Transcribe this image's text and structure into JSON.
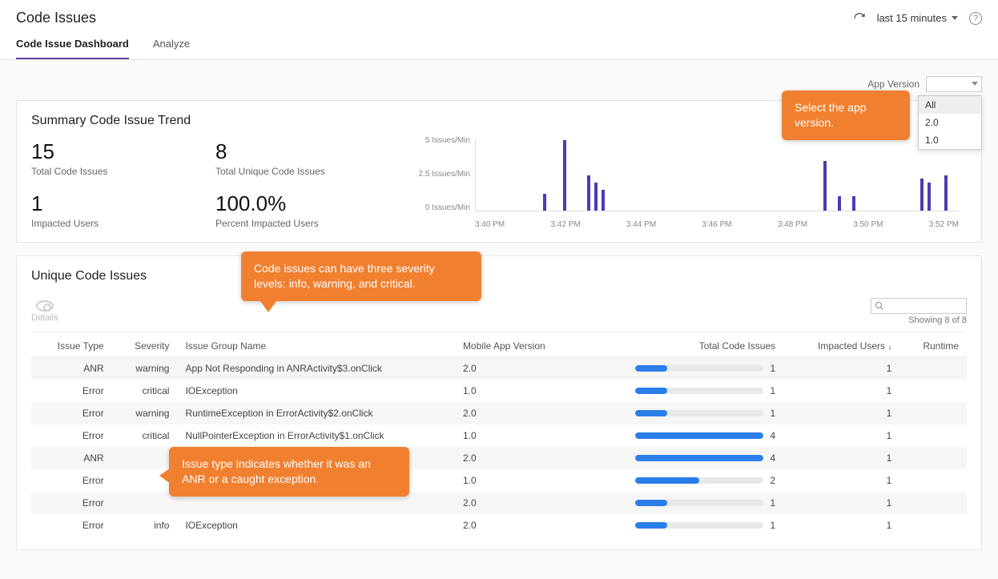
{
  "header": {
    "title": "Code Issues",
    "time_range": "last 15 minutes"
  },
  "tabs": [
    {
      "label": "Code Issue Dashboard",
      "active": true
    },
    {
      "label": "Analyze",
      "active": false
    }
  ],
  "app_version": {
    "label": "App Version",
    "selected": "",
    "options": [
      "All",
      "2.0",
      "1.0"
    ]
  },
  "summary": {
    "title": "Summary Code Issue Trend",
    "metrics": [
      {
        "value": "15",
        "label": "Total Code Issues"
      },
      {
        "value": "8",
        "label": "Total Unique Code Issues"
      },
      {
        "value": "1",
        "label": "Impacted Users"
      },
      {
        "value": "100.0%",
        "label": "Percent Impacted Users"
      }
    ]
  },
  "chart_data": {
    "type": "bar",
    "ylabel_suffix": "Issues/Min",
    "yticks": [
      "5 Issues/Min",
      "2.5 Issues/Min",
      "0 Issues/Min"
    ],
    "ylim": [
      0,
      5
    ],
    "xlabels": [
      "3:40 PM",
      "3:42 PM",
      "3:44 PM",
      "3:46 PM",
      "3:48 PM",
      "3:50 PM",
      "3:52 PM"
    ],
    "bars": [
      {
        "xpct": 14,
        "value": 1.2
      },
      {
        "xpct": 18,
        "value": 5.0
      },
      {
        "xpct": 23,
        "value": 2.5
      },
      {
        "xpct": 24.5,
        "value": 2.0
      },
      {
        "xpct": 26,
        "value": 1.5
      },
      {
        "xpct": 72,
        "value": 3.5
      },
      {
        "xpct": 75,
        "value": 1.0
      },
      {
        "xpct": 78,
        "value": 1.0
      },
      {
        "xpct": 92,
        "value": 2.3
      },
      {
        "xpct": 93.5,
        "value": 2.0
      },
      {
        "xpct": 97,
        "value": 2.5
      }
    ]
  },
  "callouts": {
    "version": "Select the app version.",
    "severity": "Code issues can have three severity levels: info, warning, and critical.",
    "type": "Issue type indicates whether it was an ANR or a caught exception."
  },
  "unique": {
    "title": "Unique Code Issues",
    "details_label": "Details",
    "showing": "Showing 8 of 8",
    "columns": [
      "Issue Type",
      "Severity",
      "Issue Group Name",
      "Mobile App Version",
      "Total Code Issues",
      "Impacted Users",
      "Runtime"
    ],
    "max_total": 4,
    "rows": [
      {
        "type": "ANR",
        "severity": "warning",
        "group": "App Not Responding in ANRActivity$3.onClick",
        "ver": "2.0",
        "total": 1,
        "users": 1,
        "runtime": ""
      },
      {
        "type": "Error",
        "severity": "critical",
        "group": "IOException",
        "ver": "1.0",
        "total": 1,
        "users": 1,
        "runtime": ""
      },
      {
        "type": "Error",
        "severity": "warning",
        "group": "RuntimeException in ErrorActivity$2.onClick",
        "ver": "2.0",
        "total": 1,
        "users": 1,
        "runtime": ""
      },
      {
        "type": "Error",
        "severity": "critical",
        "group": "NullPointerException in ErrorActivity$1.onClick",
        "ver": "1.0",
        "total": 4,
        "users": 1,
        "runtime": ""
      },
      {
        "type": "ANR",
        "severity": "",
        "group": "",
        "ver": "2.0",
        "total": 4,
        "users": 1,
        "runtime": ""
      },
      {
        "type": "Error",
        "severity": "",
        "group": "",
        "ver": "1.0",
        "total": 2,
        "users": 1,
        "runtime": ""
      },
      {
        "type": "Error",
        "severity": "",
        "group": "",
        "ver": "2.0",
        "total": 1,
        "users": 1,
        "runtime": ""
      },
      {
        "type": "Error",
        "severity": "info",
        "group": "IOException",
        "ver": "2.0",
        "total": 1,
        "users": 1,
        "runtime": ""
      }
    ]
  }
}
